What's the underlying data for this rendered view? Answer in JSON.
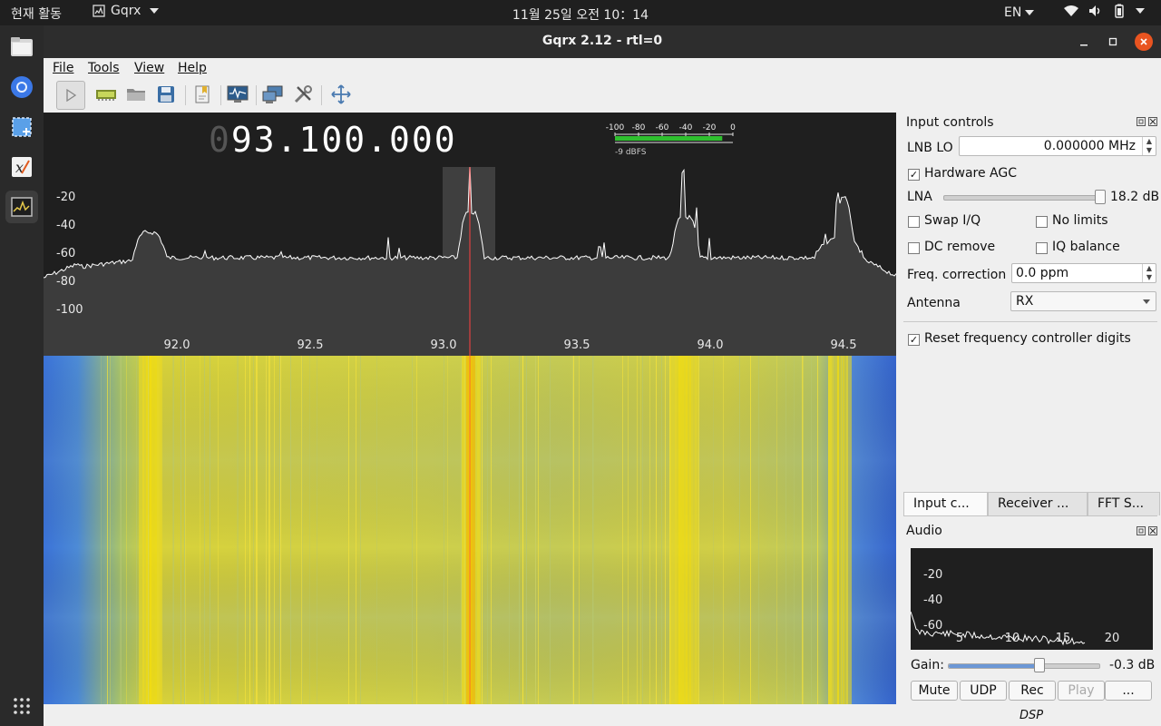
{
  "topbar": {
    "activities": "현재 활동",
    "app_name": "Gqrx",
    "clock": "11월 25일 오전 10：14",
    "language": "EN"
  },
  "window": {
    "title": "Gqrx 2.12 - rtl=0"
  },
  "menu": {
    "file": "File",
    "tools": "Tools",
    "view": "View",
    "help": "Help"
  },
  "frequency": {
    "leading": "0",
    "value": "93.100.000"
  },
  "signal_meter": {
    "scale": [
      "-100",
      "-80",
      "-60",
      "-40",
      "-20",
      "0"
    ],
    "reading": "-9 dBFS",
    "level_fraction": 0.91
  },
  "spectrum": {
    "y_ticks": [
      "-20",
      "-40",
      "-60",
      "-80",
      "-100"
    ],
    "x_ticks": [
      "92.0",
      "92.5",
      "93.0",
      "93.5",
      "94.0",
      "94.5"
    ]
  },
  "input_controls": {
    "title": "Input controls",
    "lnb_label": "LNB LO",
    "lnb_value": "0.000000 MHz",
    "hw_agc_label": "Hardware AGC",
    "hw_agc_checked": true,
    "lna_label": "LNA",
    "lna_value": "18.2 dB",
    "lna_fraction": 0.98,
    "swap_iq_label": "Swap I/Q",
    "no_limits_label": "No limits",
    "dc_remove_label": "DC remove",
    "iq_balance_label": "IQ balance",
    "freq_corr_label": "Freq. correction",
    "freq_corr_value": "0.0 ppm",
    "antenna_label": "Antenna",
    "antenna_value": "RX",
    "reset_label": "Reset frequency controller digits",
    "reset_checked": true
  },
  "tabs": [
    "Input c...",
    "Receiver ...",
    "FFT S..."
  ],
  "audio": {
    "title": "Audio",
    "y_ticks": [
      "-20",
      "-40",
      "-60"
    ],
    "x_ticks": [
      "5",
      "10",
      "15",
      "20"
    ],
    "gain_label": "Gain:",
    "gain_value": "-0.3 dB",
    "gain_fraction": 0.6,
    "mute": "Mute",
    "udp": "UDP",
    "rec": "Rec",
    "play": "Play",
    "more": "...",
    "dsp": "DSP"
  },
  "colors": {
    "accent_close": "#e95420",
    "meter_green": "#2fbf2f",
    "center_line": "#ff4040"
  }
}
